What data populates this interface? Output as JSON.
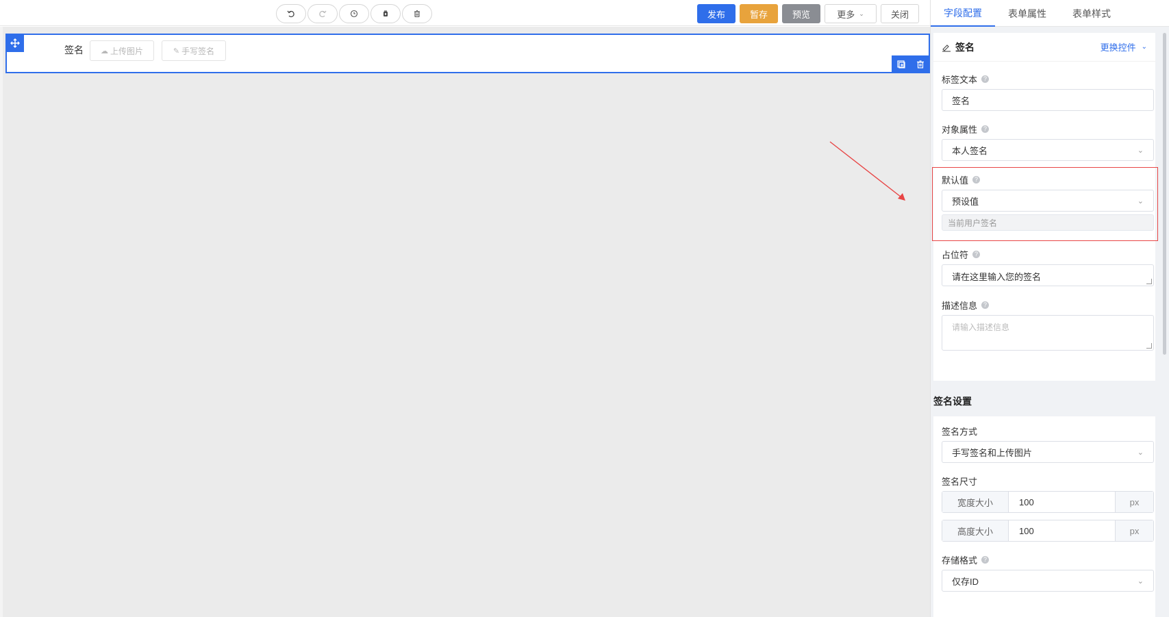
{
  "toolbar": {
    "publish_label": "发布",
    "save_label": "暂存",
    "preview_label": "预览",
    "more_label": "更多",
    "close_label": "关闭",
    "history_icons": [
      "undo-icon",
      "redo-icon",
      "history-icon",
      "clear-icon",
      "delete-icon"
    ]
  },
  "canvas": {
    "field_label": "签名",
    "upload_label": "上传图片",
    "handwrite_label": "手写签名"
  },
  "panel": {
    "tabs": [
      {
        "label": "字段配置",
        "active": true
      },
      {
        "label": "表单属性",
        "active": false
      },
      {
        "label": "表单样式",
        "active": false
      }
    ],
    "control_name": "签名",
    "switch_label": "更换控件",
    "label_text": {
      "label": "标签文本",
      "value": "签名"
    },
    "object_prop": {
      "label": "对象属性",
      "value": "本人签名"
    },
    "default_value": {
      "label": "默认值",
      "value": "预设值",
      "hint": "当前用户签名"
    },
    "placeholder": {
      "label": "占位符",
      "value": "请在这里输入您的签名"
    },
    "description": {
      "label": "描述信息",
      "placeholder": "请输入描述信息"
    },
    "signature_settings": {
      "title": "签名设置",
      "mode": {
        "label": "签名方式",
        "value": "手写签名和上传图片"
      },
      "size": {
        "label": "签名尺寸",
        "width_label": "宽度大小",
        "width_value": "100",
        "height_label": "高度大小",
        "height_value": "100",
        "unit": "px"
      },
      "storage": {
        "label": "存储格式",
        "value": "仅存ID"
      }
    }
  },
  "colors": {
    "accent": "#2f6eea",
    "save": "#e8a33c",
    "preview": "#8a8d93",
    "highlight": "#e84545"
  }
}
